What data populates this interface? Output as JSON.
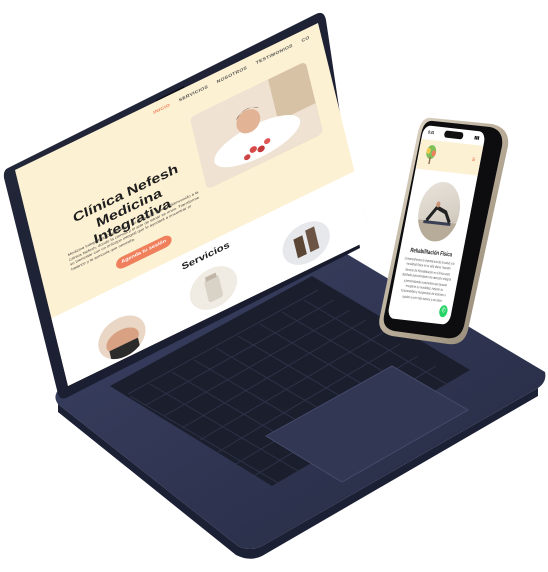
{
  "nav": {
    "items": [
      "INICIO",
      "SERVICIOS",
      "NOSOTROS",
      "TESTIMONIOS",
      "CO"
    ],
    "active_index": 0
  },
  "hero": {
    "title": "Clínica Nefesh Medicina Integrativa",
    "description": "Medicina Integrativa: Despertando Su Potencial Interior. Bienvenido a la Clínica Nefesh, donde la ciencia y el arte de sanar se unen. Transforme su bienestar con un enfoque integral que le ayudará a encontrar el balance y la armonía que necesita.",
    "cta_label": "Agenda tu sesión"
  },
  "services": {
    "title": "Servicios"
  },
  "phone": {
    "time": "9:41",
    "service_title": "Rehabilitación Física",
    "service_text": "Comprendemos la importancia de la salud y la movilidad física en tu vida diaria. Nuestro Servicio de Rehabilitación en Clínica está diseñado para brindarte una atención integral y personalizada a pacientes que buscan recuperar su movilidad, mejorar su funcionalidad y recuperarse de lesiones o ayudar a vivir más activos y sin dolor."
  },
  "colors": {
    "accent": "#f07f5c",
    "hero_bg": "#fdf1d3",
    "laptop_body": "#2e3350",
    "whatsapp": "#25d366"
  }
}
